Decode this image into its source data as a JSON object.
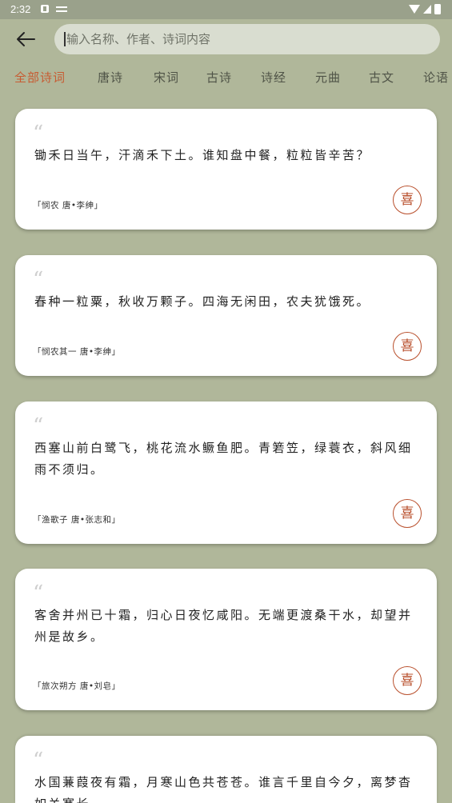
{
  "status_bar": {
    "time": "2:32"
  },
  "search": {
    "placeholder": "输入名称、作者、诗词内容",
    "value": ""
  },
  "tabs": [
    {
      "label": "全部诗词",
      "active": true
    },
    {
      "label": "唐诗"
    },
    {
      "label": "宋词"
    },
    {
      "label": "古诗"
    },
    {
      "label": "诗经"
    },
    {
      "label": "元曲"
    },
    {
      "label": "古文"
    },
    {
      "label": "论语"
    }
  ],
  "poems": [
    {
      "text": "锄禾日当午，汗滴禾下土。谁知盘中餐，粒粒皆辛苦？",
      "source": "「悯农 唐•李绅」",
      "like_label": "喜"
    },
    {
      "text": "春种一粒粟，秋收万颗子。四海无闲田，农夫犹饿死。",
      "source": "「悯农其一 唐•李绅」",
      "like_label": "喜"
    },
    {
      "text": "西塞山前白鹭飞，桃花流水鳜鱼肥。青箬笠，绿蓑衣，斜风细雨不须归。",
      "source": "「渔歌子 唐•张志和」",
      "like_label": "喜"
    },
    {
      "text": "客舍并州已十霜，归心日夜忆咸阳。无端更渡桑干水，却望并州是故乡。",
      "source": "「旅次朔方 唐•刘皂」",
      "like_label": "喜"
    },
    {
      "text": "水国蒹葭夜有霜，月寒山色共苍苍。谁言千里自今夕，离梦杳如关塞长。",
      "source": "",
      "like_label": ""
    }
  ],
  "colors": {
    "background": "#b0b79a",
    "accent": "#c75b32",
    "card": "#ffffff"
  },
  "quote_glyph": "“"
}
